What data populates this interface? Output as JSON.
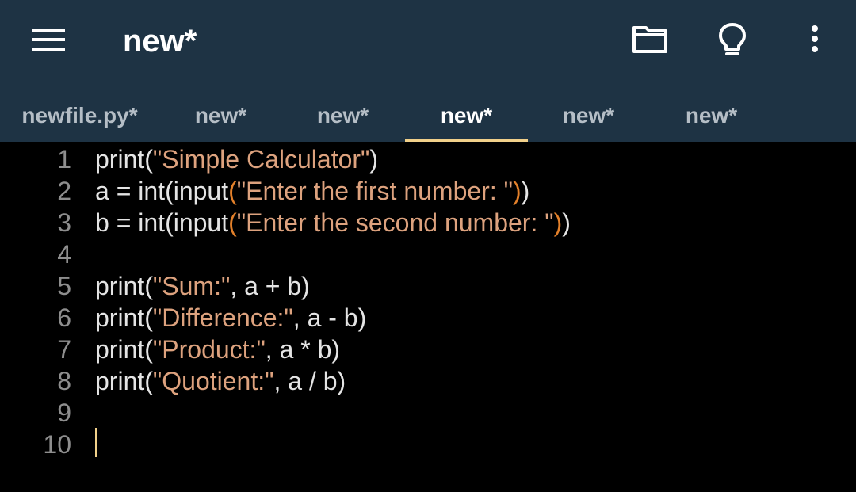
{
  "toolbar": {
    "title": "new*",
    "icons": {
      "menu": "hamburger-menu-icon",
      "open": "folder-icon",
      "hints": "lightbulb-icon",
      "more": "more-vertical-icon"
    }
  },
  "tabs": [
    {
      "label": "newfile.py*",
      "active": false
    },
    {
      "label": "new*",
      "active": false
    },
    {
      "label": "new*",
      "active": false
    },
    {
      "label": "new*",
      "active": true
    },
    {
      "label": "new*",
      "active": false
    },
    {
      "label": "new*",
      "active": false
    }
  ],
  "editor": {
    "line_numbers": [
      "1",
      "2",
      "3",
      "4",
      "5",
      "6",
      "7",
      "8",
      "9",
      "10"
    ],
    "code": [
      {
        "pre": "print(",
        "str": "\"Simple Calculator\"",
        "post": ")"
      },
      {
        "pre": "a = int(input",
        "open": "(",
        "str": "\"Enter the first number: \"",
        "close": ")",
        "post": ")"
      },
      {
        "pre": "b = int(input",
        "open": "(",
        "str": "\"Enter the second number: \"",
        "close": ")",
        "post": ")"
      },
      {
        "pre": ""
      },
      {
        "pre": "print(",
        "str": "\"Sum:\"",
        "post": ", a + b)"
      },
      {
        "pre": "print(",
        "str": "\"Difference:\"",
        "post": ", a - b)"
      },
      {
        "pre": "print(",
        "str": "\"Product:\"",
        "post": ", a * b)"
      },
      {
        "pre": "print(",
        "str": "\"Quotient:\"",
        "post": ", a / b)"
      },
      {
        "pre": ""
      },
      {
        "pre": ""
      }
    ]
  },
  "colors": {
    "toolbar_bg": "#1e3344",
    "editor_bg": "#000000",
    "string": "#dda27e",
    "paren_highlight": "#e3802a",
    "tab_indicator": "#f1d08a",
    "cursor": "#f1d08a"
  }
}
